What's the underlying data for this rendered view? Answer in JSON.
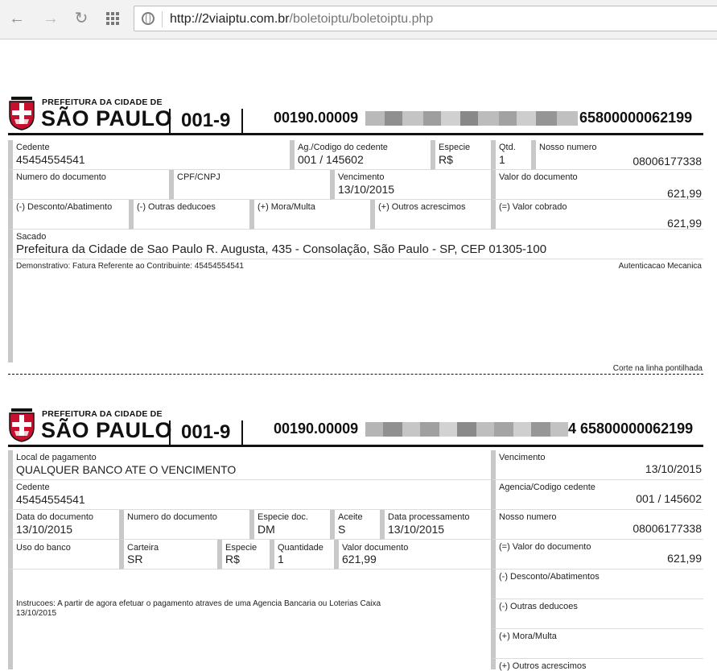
{
  "browser": {
    "back_icon": "back-arrow-icon",
    "forward_icon": "forward-arrow-icon",
    "reload_icon": "reload-icon",
    "apps_icon": "apps-grid-icon",
    "site_icon": "globe-icon",
    "url_host": "http://2viaiptu.com.br",
    "url_path": "/boletoiptu/boletoiptu.php"
  },
  "logo": {
    "small": "PREFEITURA DA CIDADE DE",
    "big": "SÃO PAULO"
  },
  "receipt": {
    "bank_code": "001-9",
    "line_start": "00190.00009",
    "line_end": "65800000062199",
    "cedente_label": "Cedente",
    "cedente_value": "45454554541",
    "agencia_label": "Ag./Codigo do cedente",
    "agencia_value": "001 / 145602",
    "especie_label": "Especie",
    "especie_value": "R$",
    "qtd_label": "Qtd.",
    "qtd_value": "1",
    "nosso_label": "Nosso numero",
    "nosso_value": "08006177338",
    "numdoc_label": "Numero do documento",
    "cpf_label": "CPF/CNPJ",
    "venc_label": "Vencimento",
    "venc_value": "13/10/2015",
    "valordoc_label": "Valor do documento",
    "valordoc_value": "621,99",
    "desconto_label": "(-) Desconto/Abatimento",
    "outras_label": "(-) Outras deducoes",
    "mora_label": "(+) Mora/Multa",
    "acresc_label": "(+) Outros acrescimos",
    "cobrado_label": "(=) Valor cobrado",
    "cobrado_value": "621,99",
    "sacado_label": "Sacado",
    "sacado_value": "Prefeitura da Cidade de Sao Paulo R. Augusta, 435 - Consolação, São Paulo - SP, CEP 01305-100",
    "demonstrativo": "Demonstrativo: Fatura Referente ao Contribuinte: 45454554541",
    "autenticacao": "Autenticacao Mecanica",
    "corte": "Corte na linha pontilhada"
  },
  "ficha": {
    "bank_code": "001-9",
    "line_start": "00190.00009",
    "line_end": "4 65800000062199",
    "local_label": "Local de pagamento",
    "local_value": "QUALQUER BANCO ATE O VENCIMENTO",
    "venc_label": "Vencimento",
    "venc_value": "13/10/2015",
    "cedente_label": "Cedente",
    "cedente_value": "45454554541",
    "agencia_label": "Agencia/Codigo cedente",
    "agencia_value": "001 / 145602",
    "datadoc_label": "Data do documento",
    "datadoc_value": "13/10/2015",
    "numdoc_label": "Numero do documento",
    "especiedoc_label": "Especie doc.",
    "especiedoc_value": "DM",
    "aceite_label": "Aceite",
    "aceite_value": "S",
    "dataproc_label": "Data processamento",
    "dataproc_value": "13/10/2015",
    "nosso_label": "Nosso numero",
    "nosso_value": "08006177338",
    "uso_label": "Uso do banco",
    "carteira_label": "Carteira",
    "carteira_value": "SR",
    "especie_label": "Especie",
    "especie_value": "R$",
    "quantidade_label": "Quantidade",
    "quantidade_value": "1",
    "valordoc_label": "Valor documento",
    "valordoc_value": "621,99",
    "valordoc2_label": "(=) Valor do documento",
    "valordoc2_value": "621,99",
    "desconto_label": "(-) Desconto/Abatimentos",
    "outras_label": "(-) Outras deducoes",
    "mora_label": "(+) Mora/Multa",
    "acresc_label": "(+) Outros acrescimos",
    "instrucoes": "Instrucoes: A partir de agora efetuar o pagamento atraves de uma Agencia Bancaria ou Loterias Caixa",
    "instrucoes_date": "13/10/2015"
  },
  "colors": {
    "brasao_red": "#c8102e",
    "cell_border": "#c8c8c8"
  }
}
